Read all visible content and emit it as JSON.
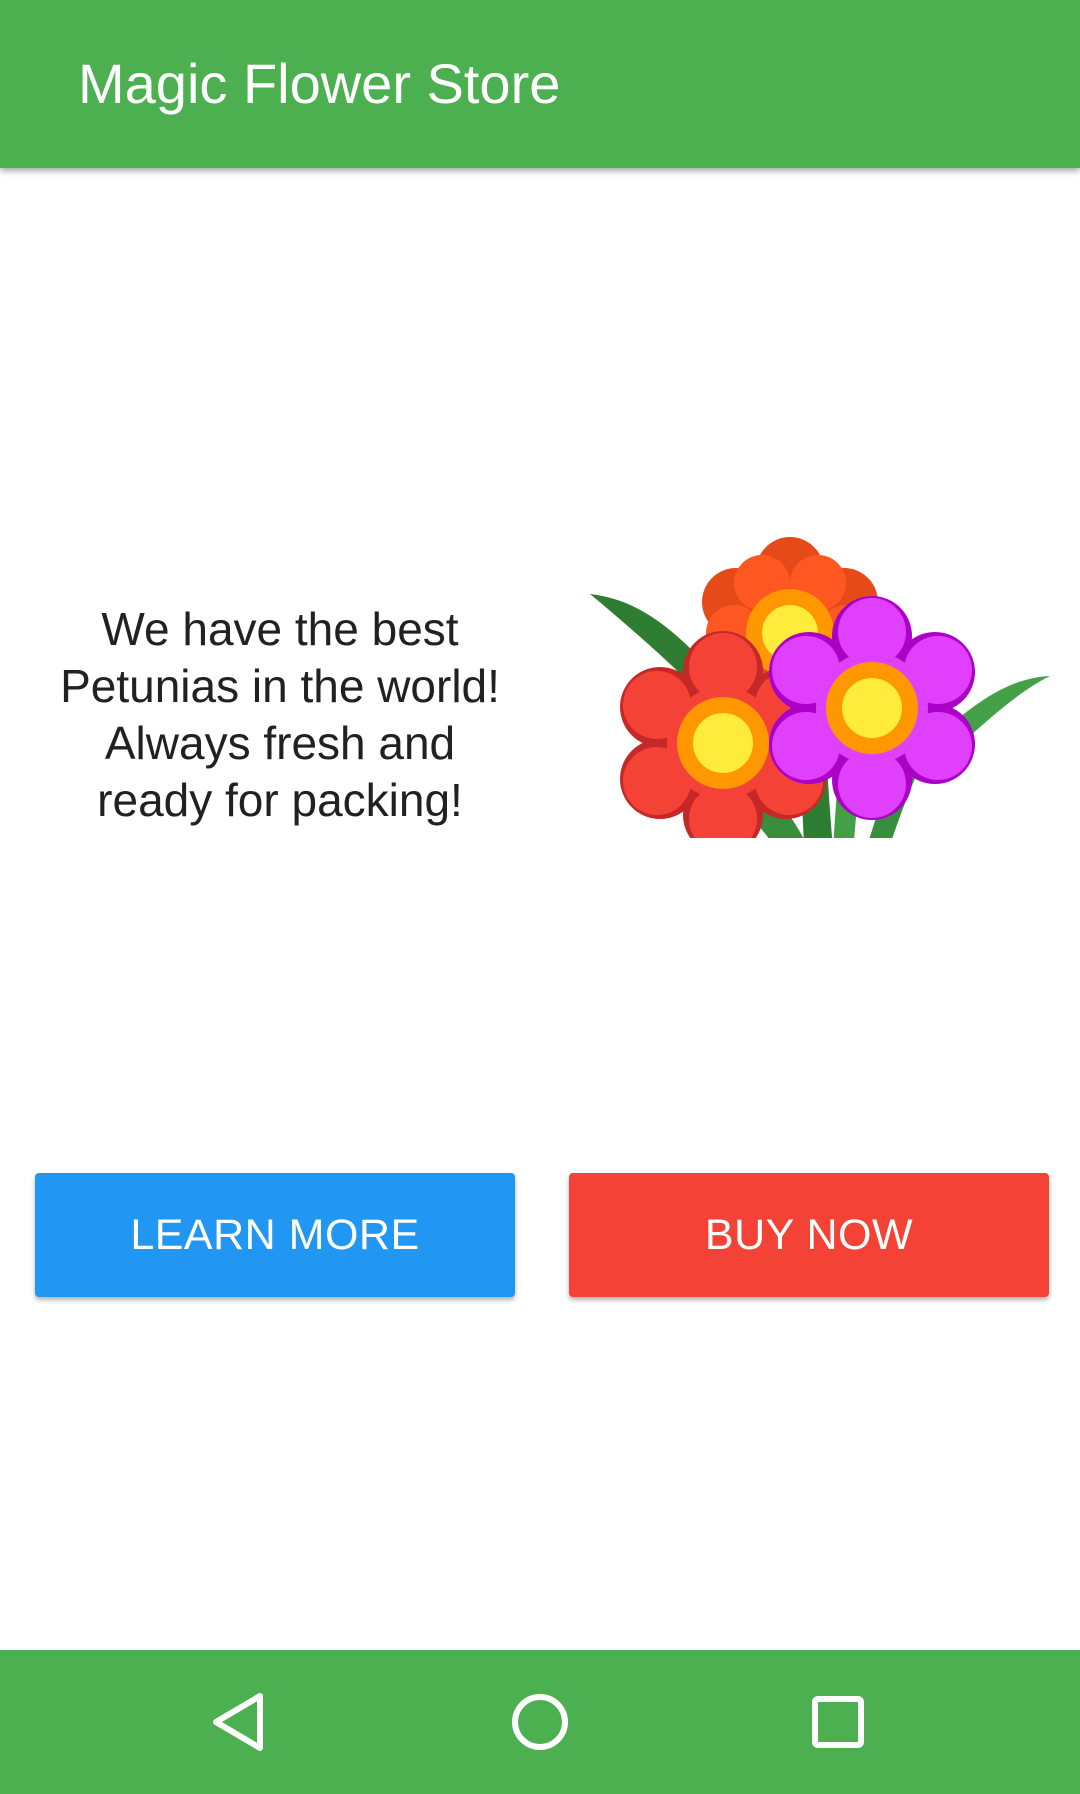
{
  "app_bar": {
    "title": "Magic Flower Store",
    "color": "#4caf50"
  },
  "promo": {
    "lines": [
      "We have the best",
      "Petunias in the world!",
      "Always fresh and",
      "ready for packing!"
    ],
    "illustration": "flower-bouquet-icon"
  },
  "buttons": {
    "learn_more": {
      "label": "LEARN MORE",
      "color": "#2196f3"
    },
    "buy_now": {
      "label": "BUY NOW",
      "color": "#f44336"
    }
  },
  "nav_bar": {
    "color": "#4caf50",
    "items": [
      "back-icon",
      "home-icon",
      "recents-icon"
    ]
  }
}
